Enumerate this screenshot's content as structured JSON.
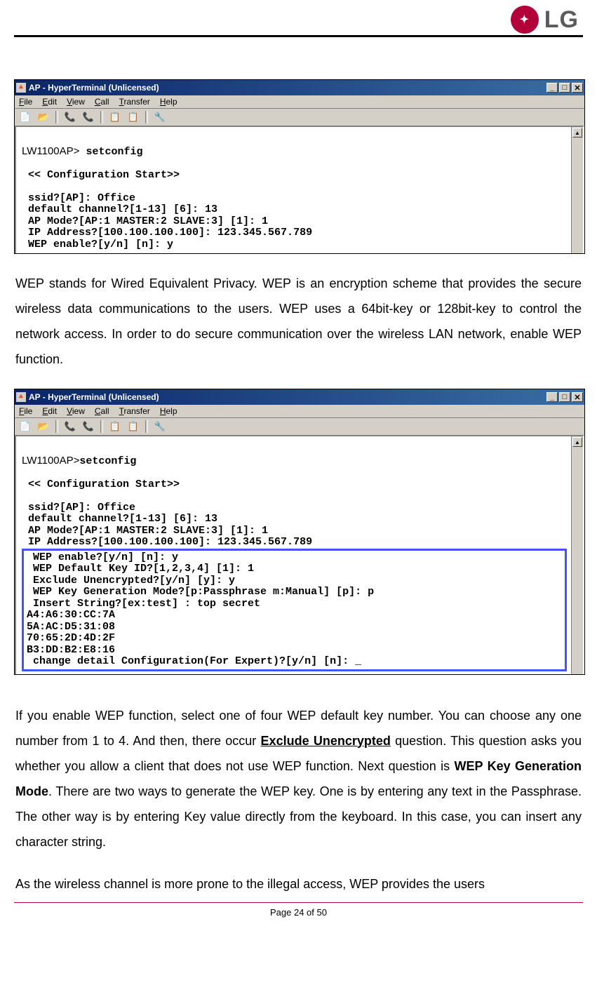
{
  "brand": {
    "logo_text": "LG",
    "logo_inner": "✦"
  },
  "footer": {
    "page_label": "Page 24 of 50"
  },
  "paragraphs": {
    "p1": "WEP stands for Wired Equivalent Privacy. WEP is an encryption scheme that provides the secure wireless data communications to the users. WEP uses a 64bit-key or 128bit-key to control the network access. In order to do secure communication over the wireless LAN network, enable WEP function.",
    "p2_part1": "If you enable WEP function, select one of four WEP default key number. You can choose any one number from 1 to 4. And then, there occur ",
    "p2_bold1": "Exclude Unencrypted",
    "p2_part2": " question. This question asks you whether you allow a client that does not use WEP function. Next question is ",
    "p2_bold2": "WEP Key Generation Mode",
    "p2_part3": ". There are two ways to generate the WEP key. One is by entering any text in the Passphrase. The other way is by entering Key value directly from the keyboard. In this case, you can insert any character string.",
    "p3": "As the wireless channel is more prone to the illegal access, WEP provides the users"
  },
  "window": {
    "title": "AP - HyperTerminal (Unlicensed)",
    "menus": [
      "File",
      "Edit",
      "View",
      "Call",
      "Transfer",
      "Help"
    ],
    "btn_min": "_",
    "btn_max": "□",
    "btn_close": "✕",
    "toolbar_icons": [
      "📄",
      "📂",
      "📞",
      "📞",
      "📋",
      "📋",
      "🔧"
    ]
  },
  "terminal1": {
    "prompt": "LW1100AP>",
    "cmd": "setconfig",
    "l1": " << Configuration Start>>",
    "l2": " ssid?[AP]: Office",
    "l3": " default channel?[1-13] [6]: 13",
    "l4": " AP Mode?[AP:1 MASTER:2 SLAVE:3] [1]: 1",
    "l5": " IP Address?[100.100.100.100]: 123.345.567.789",
    "l6": " WEP enable?[y/n] [n]: y"
  },
  "terminal2": {
    "prompt": "LW1100AP>",
    "cmd": "setconfig",
    "l1": " << Configuration Start>>",
    "l2": " ssid?[AP]: Office",
    "l3": " default channel?[1-13] [6]: 13",
    "l4": " AP Mode?[AP:1 MASTER:2 SLAVE:3] [1]: 1",
    "l5": " IP Address?[100.100.100.100]: 123.345.567.789",
    "h1": " WEP enable?[y/n] [n]: y",
    "h2": " WEP Default Key ID?[1,2,3,4] [1]: 1",
    "h3": " Exclude Unencrypted?[y/n] [y]: y",
    "h4": " WEP Key Generation Mode?[p:Passphrase m:Manual] [p]: p",
    "h5": " Insert String?[ex:test] : top secret",
    "h6": "A4:A6:30:CC:7A",
    "h7": "5A:AC:D5:31:08",
    "h8": "70:65:2D:4D:2F",
    "h9": "B3:DD:B2:E8:16",
    "h10": " change detail Configuration(For Expert)?[y/n] [n]: _"
  }
}
